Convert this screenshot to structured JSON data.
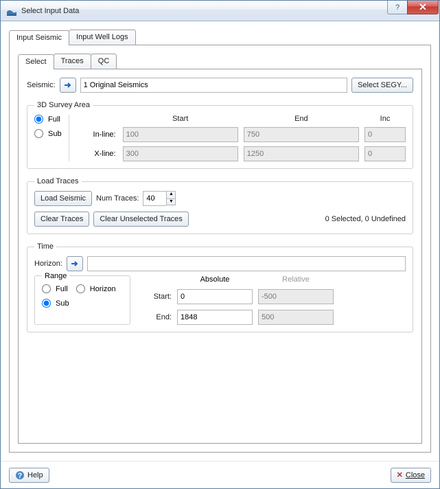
{
  "window": {
    "title": "Select Input Data"
  },
  "outerTabs": {
    "t0": "Input Seismic",
    "t1": "Input Well Logs"
  },
  "innerTabs": {
    "t0": "Select",
    "t1": "Traces",
    "t2": "QC"
  },
  "seismic": {
    "label": "Seismic:",
    "value": "1 Original Seismics",
    "selectSEGY": "Select SEGY..."
  },
  "survey": {
    "legend": "3D Survey Area",
    "radioFull": "Full",
    "radioSub": "Sub",
    "hdrStart": "Start",
    "hdrEnd": "End",
    "hdrInc": "Inc",
    "inlineLabel": "In-line:",
    "xlineLabel": "X-line:",
    "inline": {
      "start": "100",
      "end": "750",
      "inc": "0"
    },
    "xline": {
      "start": "300",
      "end": "1250",
      "inc": "0"
    }
  },
  "load": {
    "legend": "Load Traces",
    "loadSeismic": "Load Seismic",
    "numTracesLabel": "Num Traces:",
    "numTraces": "40",
    "clearTraces": "Clear Traces",
    "clearUnselected": "Clear Unselected Traces",
    "status": "0 Selected, 0 Undefined"
  },
  "time": {
    "legend": "Time",
    "horizonLabel": "Horizon:",
    "horizonValue": "",
    "rangeLegend": "Range",
    "radioFull": "Full",
    "radioHorizon": "Horizon",
    "radioSub": "Sub",
    "absHdr": "Absolute",
    "relHdr": "Relative",
    "startLabel": "Start:",
    "endLabel": "End:",
    "abs": {
      "start": "0",
      "end": "1848"
    },
    "rel": {
      "start": "-500",
      "end": "500"
    }
  },
  "footer": {
    "help": "Help",
    "close": "Close"
  }
}
